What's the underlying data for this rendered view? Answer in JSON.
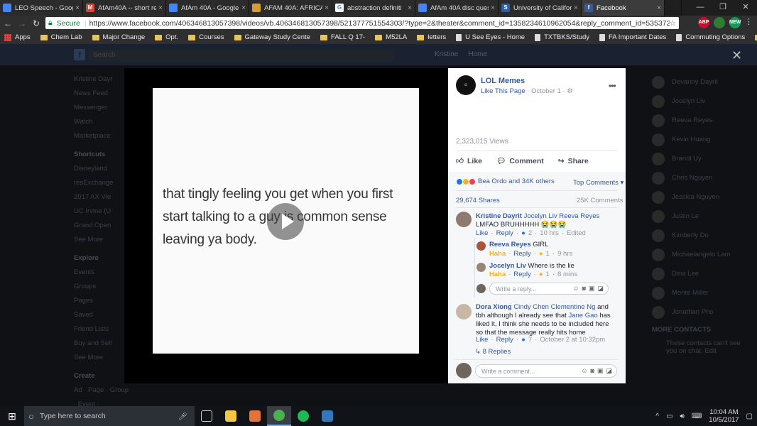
{
  "browser": {
    "tabs": [
      {
        "title": "LEO Speech - Google",
        "icon_color": "#4285f4",
        "icon_letter": ""
      },
      {
        "title": "AfAm40A -- short re",
        "icon_color": "#d44638",
        "icon_letter": "M"
      },
      {
        "title": "AfAm 40A - Google",
        "icon_color": "#4285f4",
        "icon_letter": ""
      },
      {
        "title": "AFAM 40A: AFRICAN",
        "icon_color": "#d69e2e",
        "icon_letter": ""
      },
      {
        "title": "abstraction definiti",
        "icon_color": "#ffffff",
        "icon_letter": "G"
      },
      {
        "title": "AfAm 40A disc ques",
        "icon_color": "#4285f4",
        "icon_letter": ""
      },
      {
        "title": "University of Califor",
        "icon_color": "#2d5fa6",
        "icon_letter": "S"
      },
      {
        "title": "Facebook",
        "icon_color": "#3b5998",
        "icon_letter": "f",
        "active": true
      }
    ],
    "window_controls": [
      "—",
      "❐",
      "✕"
    ],
    "secure_label": "Secure",
    "url": "https://www.facebook.com/406346813057398/videos/vb.406346813057398/521377751554303/?type=2&theater&comment_id=1358234610962054&reply_comment_id=535372963474785&n...",
    "extensions": [
      {
        "label": "ABP",
        "color": "#c70d2c"
      },
      {
        "label": "",
        "color": "#2e7d32"
      },
      {
        "label": "NEW",
        "color": "#0f9d58"
      }
    ],
    "bookmarks": [
      {
        "label": "Apps",
        "type": "apps"
      },
      {
        "label": "Chem Lab",
        "type": "folder"
      },
      {
        "label": "Major Change",
        "type": "folder"
      },
      {
        "label": "Opt.",
        "type": "folder"
      },
      {
        "label": "Courses",
        "type": "folder"
      },
      {
        "label": "Gateway Study Cente",
        "type": "folder"
      },
      {
        "label": "FALL Q 17-",
        "type": "folder"
      },
      {
        "label": "M52LA",
        "type": "folder"
      },
      {
        "label": "letters",
        "type": "folder"
      },
      {
        "label": "U See Eyes - Home",
        "type": "page"
      },
      {
        "label": "TXTBKS/Study",
        "type": "page"
      },
      {
        "label": "FA Important Dates",
        "type": "page"
      },
      {
        "label": "Commuting Options",
        "type": "page"
      },
      {
        "label": "Utilities",
        "type": "folder"
      }
    ]
  },
  "fb_background": {
    "search_placeholder": "Search",
    "top_nav": [
      "Kristine",
      "Home"
    ],
    "user": "Kristine Dayr",
    "left_items": [
      "News Feed",
      "Messenger",
      "Watch",
      "Marketplace"
    ],
    "shortcuts_header": "Shortcuts",
    "shortcuts": [
      "Disneyland",
      "resExchange",
      "2017 AX Vie",
      "UC Irvine (U",
      "Grand Open",
      "See More"
    ],
    "explore_header": "Explore",
    "explore": [
      "Events",
      "Groups",
      "Pages",
      "Saved",
      "Friend Lists",
      "Buy and Sell",
      "See More"
    ],
    "create_header": "Create",
    "create_items": "Ad · Page · Group · Event · Fundraiser",
    "contacts": [
      "Devanny Dayrit",
      "Jocelyn Liv",
      "Reeva Reyes",
      "Kevin Huang",
      "Brandi Uy",
      "Chris Nguyen",
      "Jessica Nguyen",
      "Justin Le",
      "Kimberly Do",
      "Michaelangelo Lam",
      "Dina Lee",
      "Monte Miller",
      "Jonathan Pho"
    ],
    "more_contacts_header": "MORE CONTACTS",
    "more_contacts_note": "These contacts can't see you on chat. Edit"
  },
  "video": {
    "caption": "that tingly feeling you get when you first start talking to a guy is common sense leaving ya body."
  },
  "post": {
    "page_name": "LOL Memes",
    "like_page": "Like This Page",
    "date": "October 1",
    "views": "2,323,015 Views",
    "actions": {
      "like": "Like",
      "comment": "Comment",
      "share": "Share"
    },
    "reaction_summary": "Bea Ordo and 34K others",
    "top_comments": "Top Comments ▾",
    "shares": "29,674 Shares",
    "comments_count": "25K Comments",
    "reaction_colors": [
      "#1877f2",
      "#f7b125",
      "#f33e58"
    ]
  },
  "comments": [
    {
      "name": "Kristine Dayrit",
      "tags": "Jocelyn Liv Reeva Reyes",
      "text": "LMFAO BRUHHHHH 😭😭😭",
      "like": "Like",
      "reply": "Reply",
      "react_count": "2",
      "time": "10 hrs",
      "edited": "Edited"
    },
    {
      "name": "Reeva Reyes",
      "text": "GIRL",
      "reaction": "Haha",
      "reply": "Reply",
      "react_count": "1",
      "time": "9 hrs"
    },
    {
      "name": "Jocelyn Liv",
      "text": "Where is the lie",
      "reaction": "Haha",
      "reply": "Reply",
      "react_count": "1",
      "time": "8 mins"
    },
    {
      "name": "Dora Xiong",
      "tags": "Cindy Chen Clementine Ng",
      "text_a": "and tbh although I already see that",
      "tag_inline": "Jane Gao",
      "text_b": "has liked it, I think she needs to be included here so that the message really hits home",
      "like": "Like",
      "reply": "Reply",
      "react_count": "7",
      "time": "October 2 at 10:32pm"
    }
  ],
  "reply_placeholder": "Write a reply...",
  "more_replies": "8 Replies",
  "comment_placeholder": "Write a comment...",
  "taskbar": {
    "search_placeholder": "Type here to search",
    "apps": [
      {
        "name": "task-view",
        "color": "#cfcfcf"
      },
      {
        "name": "file-explorer",
        "color": "#f2c744"
      },
      {
        "name": "paint",
        "color": "#e3733a"
      },
      {
        "name": "chrome",
        "color": "#4caf50",
        "active": true
      },
      {
        "name": "spotify",
        "color": "#1db954"
      },
      {
        "name": "edge",
        "color": "#3277bc"
      }
    ],
    "time": "10:04 AM",
    "date": "10/5/2017"
  }
}
